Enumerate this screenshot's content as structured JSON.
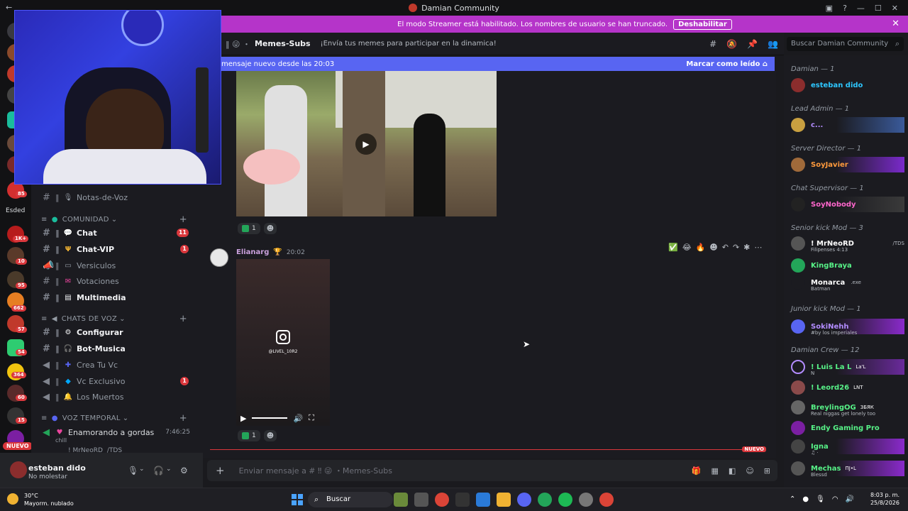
{
  "window": {
    "title": "Damian Community"
  },
  "banner": {
    "text": "El modo Streamer está habilitado. Los nombres de usuario se han truncado.",
    "disable_label": "Deshabilitar",
    "color": "#b534c9"
  },
  "channel_header": {
    "name": "Memes-Subs",
    "topic": "¡Envía tus memes para participar en la dinamica!"
  },
  "search": {
    "placeholder": "Buscar Damian Community"
  },
  "new_messages_bar": {
    "text": "mensaje nuevo desde las 20:03",
    "mark_read": "Marcar como leído"
  },
  "sidebar": {
    "server_tag": "Esded",
    "channels_top": [
      {
        "label": "Notas-de-Voz"
      }
    ],
    "categories": {
      "comunidad": "COMUNIDAD",
      "chats_voz": "CHATS DE VOZ",
      "voz_temporal": "VOZ TEMPORAL"
    },
    "comunidad_channels": [
      {
        "label": "Chat",
        "count": "11"
      },
      {
        "label": "Chat-VIP",
        "count": "1"
      },
      {
        "label": "Versiculos"
      },
      {
        "label": "Votaciones"
      },
      {
        "label": "Multimedia"
      }
    ],
    "voz_channels": [
      {
        "label": "Configurar"
      },
      {
        "label": "Bot-Musica"
      },
      {
        "label": "Crea Tu Vc"
      },
      {
        "label": "Vc Exclusivo",
        "count": "1"
      },
      {
        "label": "Los Muertos"
      }
    ],
    "temp_channel": {
      "label": "Enamorando a gordas",
      "time": "7:46:25",
      "sub": "chill",
      "member": "! MrNeoRD",
      "member_tag": "/TDS"
    },
    "nuevo": "NUEVO"
  },
  "guild_badges": [
    "85",
    "1K+",
    "10",
    "95",
    "662",
    "57",
    "54",
    "364",
    "60",
    "15"
  ],
  "user": {
    "name": "esteban dido",
    "status": "No molestar"
  },
  "messages": {
    "first_reaction_count": "1",
    "second": {
      "author": "Elianarg",
      "time": "20:02",
      "ig_handle": "@LIVEL_10R2",
      "reaction_count": "1"
    },
    "nuevo": "NUEVO"
  },
  "composer": {
    "placeholder": "Enviar mensaje a # ‼ 😜 ・Memes-Subs"
  },
  "members": {
    "roles": [
      {
        "label": "Damian — 1",
        "members": [
          {
            "name": "esteban dido",
            "color": "#2dc7ff"
          }
        ]
      },
      {
        "label": "Lead Admin — 1",
        "members": [
          {
            "name": "c...",
            "color": "#b38cff"
          }
        ]
      },
      {
        "label": "Server Director — 1",
        "members": [
          {
            "name": "SoyJavier",
            "color": "#ff9a3c"
          }
        ]
      },
      {
        "label": "Chat Supervisor — 1",
        "members": [
          {
            "name": "SoyNobody",
            "color": "#ff66cc"
          }
        ]
      },
      {
        "label": "Senior kick Mod — 3",
        "members": [
          {
            "name": "! MrNeoRD",
            "color": "#ffffff",
            "sub": "Filipenses 4:13",
            "tag": "/TDS"
          },
          {
            "name": "KingBraya",
            "color": "#57f287"
          },
          {
            "name": "Monarca",
            "color": "#ffffff",
            "sub": "Batman",
            "tag": ".exe"
          }
        ]
      },
      {
        "label": "Junior kick Mod — 1",
        "members": [
          {
            "name": "SokiNehh",
            "color": "#b38cff",
            "sub": "#by los imperiales"
          }
        ]
      },
      {
        "label": "Damian Crew — 12",
        "members": [
          {
            "name": "! Luis La L",
            "color": "#57f287",
            "sub": "N",
            "tag": "La'L"
          },
          {
            "name": "! Leord26",
            "color": "#57f287",
            "tag": "LNT"
          },
          {
            "name": "BreylingOG",
            "color": "#57f287",
            "sub": "Real niggas get lonely too",
            "tag": "ЗБЯК"
          },
          {
            "name": "Endy Gaming Pro",
            "color": "#57f287"
          },
          {
            "name": "Igna",
            "color": "#57f287",
            "sub": "♫ ·"
          },
          {
            "name": "Mechas",
            "color": "#57f287",
            "sub": "Blessd",
            "tag": "ΠЈ•L"
          }
        ]
      }
    ]
  },
  "taskbar": {
    "temperature": "30°C",
    "weather": "Mayorm. nublado",
    "search": "Buscar",
    "time": "8:03 p. m.",
    "date": "25/8/2026"
  }
}
